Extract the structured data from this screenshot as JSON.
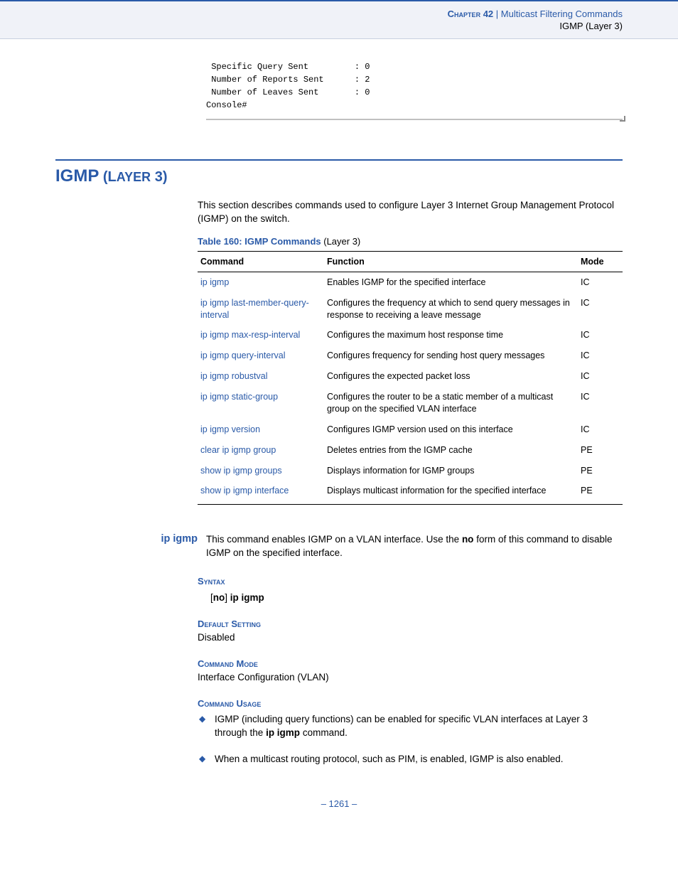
{
  "header": {
    "chapter_label": "Chapter",
    "chapter_num": "42",
    "separator": "  |  ",
    "title": "Multicast Filtering Commands",
    "subtitle": "IGMP (Layer 3)"
  },
  "codeblock": " Specific Query Sent         : 0\n Number of Reports Sent      : 2\n Number of Leaves Sent       : 0\nConsole#",
  "section": {
    "title_bold": "IGMP",
    "title_rest_open": " (L",
    "title_rest_small": "AYER",
    "title_rest_close": " 3)",
    "intro": "This section describes commands used to configure Layer 3 Internet Group Management Protocol (IGMP) on the switch."
  },
  "table": {
    "caption_bold": "Table 160: IGMP Commands",
    "caption_tail": " (Layer 3)",
    "headers": {
      "command": "Command",
      "function": "Function",
      "mode": "Mode"
    },
    "rows": [
      {
        "cmd": "ip igmp",
        "func": "Enables IGMP for the specified interface",
        "mode": "IC"
      },
      {
        "cmd": "ip igmp last-member-query-interval",
        "func": "Configures the frequency at which to send query messages in response to receiving a leave message",
        "mode": "IC"
      },
      {
        "cmd": "ip igmp max-resp-interval",
        "func": "Configures the maximum host response time",
        "mode": "IC"
      },
      {
        "cmd": "ip igmp query-interval",
        "func": "Configures frequency for sending host query messages",
        "mode": "IC"
      },
      {
        "cmd": "ip igmp robustval",
        "func": "Configures the expected packet loss",
        "mode": "IC"
      },
      {
        "cmd": "ip igmp static-group",
        "func": "Configures the router to be a static member of a multicast group on the specified VLAN interface",
        "mode": "IC"
      },
      {
        "cmd": "ip igmp version",
        "func": "Configures IGMP version used on this interface",
        "mode": "IC"
      },
      {
        "cmd": "clear ip igmp group",
        "func": "Deletes entries from the IGMP cache",
        "mode": "PE"
      },
      {
        "cmd": "show ip igmp groups",
        "func": "Displays information for IGMP groups",
        "mode": "PE"
      },
      {
        "cmd": "show ip igmp interface",
        "func": "Displays multicast information for the specified interface",
        "mode": "PE"
      }
    ]
  },
  "command": {
    "name": "ip igmp",
    "desc_pre": "This command enables IGMP on a VLAN interface. Use the ",
    "desc_bold": "no",
    "desc_post": " form of this command to disable IGMP on the specified interface.",
    "syntax_heading": "Syntax",
    "syntax_open": "[",
    "syntax_no": "no",
    "syntax_close": "] ",
    "syntax_cmd": "ip igmp",
    "default_heading": "Default Setting",
    "default_value": "Disabled",
    "mode_heading": "Command Mode",
    "mode_value": "Interface Configuration (VLAN)",
    "usage_heading": "Command Usage",
    "usage": [
      {
        "pre": "IGMP (including query functions) can be enabled for specific VLAN interfaces at Layer 3 through the ",
        "bold": "ip igmp",
        "post": " command."
      },
      {
        "pre": "When a multicast routing protocol, such as PIM, is enabled, IGMP is also enabled.",
        "bold": "",
        "post": ""
      }
    ]
  },
  "page_num": "–  1261  –"
}
